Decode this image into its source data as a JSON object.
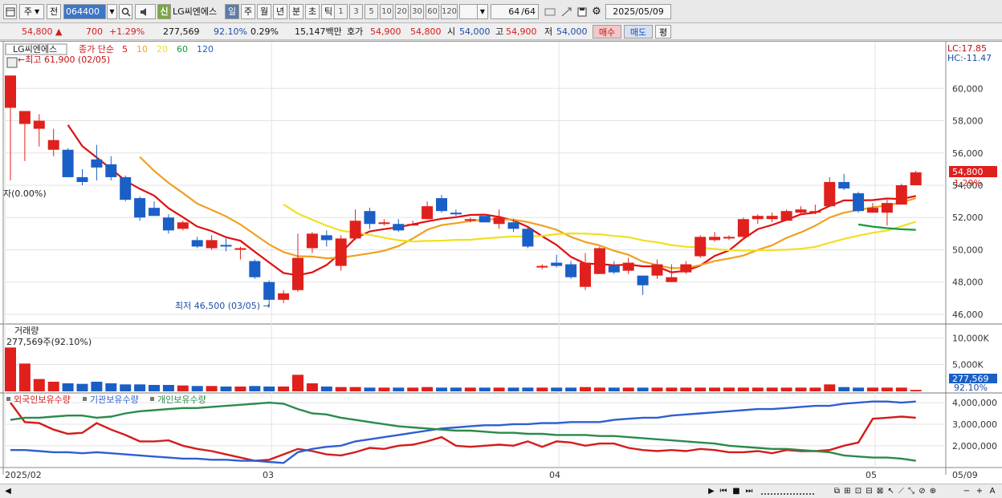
{
  "toolbar": {
    "period_label": "주",
    "prev_label": "전",
    "stock_code": "064400",
    "logo_label": "신",
    "stock_name": "LG씨엔에스",
    "periods": [
      "일",
      "주",
      "월",
      "년",
      "분",
      "초",
      "틱"
    ],
    "active_period": "일",
    "intervals": [
      "1",
      "3",
      "5",
      "10",
      "20",
      "30",
      "60",
      "120"
    ],
    "count": "64",
    "count_total": "/64",
    "date": "2025/05/09"
  },
  "quote": {
    "price": "54,800",
    "change": "700",
    "change_pct": "+1.29%",
    "volume": "277,569",
    "volume_pct": "92.10%",
    "turnover_pct": "0.29%",
    "amount": "15,147백만",
    "hoga_label": "호가",
    "ask": "54,900",
    "bid": "54,800",
    "open_label": "시",
    "open": "54,000",
    "high_label": "고",
    "high": "54,900",
    "low_label": "저",
    "low": "54,000",
    "buy_label": "매수",
    "sell_label": "매도",
    "eval_label": "평"
  },
  "chart": {
    "legend_name": "LG씨엔에스",
    "legend_ma_title": "종가 단순",
    "ma_periods": [
      "5",
      "10",
      "20",
      "60",
      "120"
    ],
    "ma_colors": [
      "#e01010",
      "#f0a020",
      "#f0e020",
      "#169a3a",
      "#1a5fc6"
    ],
    "high_annotation": "최고 61,900 (02/05)",
    "low_annotation": "최저 46,500 (03/05)",
    "lc": "LC:17.85",
    "hc": "HC:-11.47",
    "current_price": "54,800",
    "current_pct": "1.29%",
    "ratio_label": "자(0.00%)",
    "volume_title": "거래량",
    "volume_value": "277,569주(92.10%)",
    "volume_box": "277,569",
    "volume_box_pct": "92.10%",
    "holding_titles": [
      "외국인보유수량",
      "기관보유수량",
      "개인보유수량"
    ],
    "holding_colors": [
      "#d41c1c",
      "#2f5fd0",
      "#2b8a4a"
    ],
    "x_labels": [
      "2025/02",
      "03",
      "04",
      "05",
      "05/09"
    ],
    "price_ticks": [
      "60,000",
      "58,000",
      "56,000",
      "54,000",
      "52,000",
      "50,000",
      "48,000",
      "46,000"
    ],
    "volume_ticks": [
      "10,000K",
      "5,000K"
    ],
    "holding_ticks": [
      "4,000,000",
      "3,000,000",
      "2,000,000"
    ]
  },
  "chart_data": {
    "type": "candlestick",
    "candles": [
      [
        58800,
        60800,
        54300,
        60800
      ],
      [
        57800,
        58600,
        55500,
        57800
      ],
      [
        57500,
        58000,
        56400,
        58400
      ],
      [
        56200,
        56800,
        55800,
        57500
      ],
      [
        56200,
        54500,
        54500,
        56300
      ],
      [
        54500,
        54200,
        54000,
        55000
      ],
      [
        55600,
        55100,
        54300,
        56500
      ],
      [
        55300,
        54500,
        54300,
        55800
      ],
      [
        54500,
        53100,
        53000,
        54600
      ],
      [
        53200,
        52000,
        51800,
        53300
      ],
      [
        52600,
        52100,
        52100,
        53000
      ],
      [
        52000,
        51200,
        51000,
        52200
      ],
      [
        51300,
        51700,
        51200,
        51800
      ],
      [
        50600,
        50200,
        50100,
        50800
      ],
      [
        50100,
        50600,
        50000,
        50900
      ],
      [
        50300,
        50200,
        49900,
        50700
      ],
      [
        50000,
        50100,
        49400,
        50200
      ],
      [
        49300,
        48300,
        48200,
        49400
      ],
      [
        48000,
        46900,
        46500,
        48100
      ],
      [
        46900,
        47300,
        46700,
        47500
      ],
      [
        47500,
        49500,
        47400,
        51000
      ],
      [
        50100,
        51000,
        49800,
        51100
      ],
      [
        50900,
        50600,
        50200,
        51200
      ],
      [
        49000,
        50700,
        48700,
        50900
      ],
      [
        50700,
        51800,
        50600,
        52500
      ],
      [
        52400,
        51600,
        51300,
        52600
      ],
      [
        51600,
        51700,
        51500,
        51900
      ],
      [
        51600,
        51200,
        51100,
        51900
      ],
      [
        51500,
        51600,
        51500,
        51800
      ],
      [
        51900,
        52700,
        51900,
        53000
      ],
      [
        53200,
        52400,
        52300,
        53400
      ],
      [
        52300,
        52200,
        52100,
        52500
      ],
      [
        51800,
        51900,
        51700,
        52000
      ],
      [
        52100,
        51700,
        51700,
        52000
      ],
      [
        51600,
        52000,
        51300,
        52500
      ],
      [
        51700,
        51300,
        51100,
        51900
      ],
      [
        51300,
        50200,
        50100,
        51400
      ],
      [
        48900,
        49000,
        48800,
        49100
      ],
      [
        49200,
        49000,
        48900,
        49700
      ],
      [
        49100,
        48300,
        48200,
        49300
      ],
      [
        47700,
        49200,
        47500,
        49800
      ],
      [
        48500,
        50100,
        48500,
        50200
      ],
      [
        49000,
        48600,
        48500,
        49300
      ],
      [
        48700,
        49200,
        48500,
        49500
      ],
      [
        48400,
        47800,
        47200,
        48400
      ],
      [
        48400,
        49100,
        48200,
        49400
      ],
      [
        48000,
        48300,
        48000,
        49100
      ],
      [
        48600,
        49100,
        48500,
        49300
      ],
      [
        49600,
        50800,
        49500,
        50900
      ],
      [
        50600,
        50800,
        50500,
        51100
      ],
      [
        50700,
        50800,
        50600,
        50900
      ],
      [
        50800,
        51900,
        50600,
        52000
      ],
      [
        51900,
        52100,
        51600,
        52200
      ],
      [
        51900,
        52100,
        51700,
        52300
      ],
      [
        51800,
        52400,
        51800,
        52500
      ],
      [
        52300,
        52500,
        52200,
        52700
      ],
      [
        52300,
        52400,
        52200,
        52800
      ],
      [
        52700,
        54200,
        52700,
        54500
      ],
      [
        54200,
        53800,
        53700,
        54700
      ],
      [
        53500,
        52400,
        52300,
        53600
      ],
      [
        52300,
        52600,
        52300,
        52900
      ],
      [
        52300,
        52900,
        51500,
        53100
      ],
      [
        52800,
        54000,
        52800,
        54100
      ],
      [
        54000,
        54800,
        54000,
        54900
      ]
    ],
    "volumes_k": [
      8200,
      5200,
      2300,
      1800,
      1500,
      1400,
      1800,
      1500,
      1300,
      1300,
      1200,
      1200,
      1100,
      1000,
      1000,
      900,
      900,
      1000,
      900,
      900,
      3100,
      1500,
      900,
      800,
      800,
      700,
      700,
      700,
      700,
      800,
      700,
      700,
      700,
      700,
      700,
      700,
      700,
      700,
      700,
      700,
      800,
      700,
      700,
      700,
      700,
      700,
      700,
      700,
      700,
      700,
      700,
      700,
      700,
      700,
      700,
      700,
      700,
      1300,
      800,
      700,
      700,
      700,
      700,
      278
    ],
    "ylim": [
      45500,
      62500
    ]
  }
}
